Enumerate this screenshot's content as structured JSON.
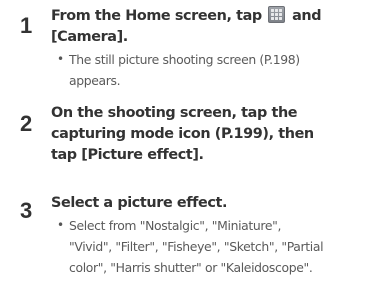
{
  "steps": [
    {
      "number": "1",
      "heading_lines": [
        "From the Home screen, tap",
        "and",
        "[Camera]."
      ],
      "icon": "apps-grid-icon",
      "body_lines": [
        "The still picture shooting screen (P.198)",
        "appears."
      ]
    },
    {
      "number": "2",
      "heading_lines": [
        "On the shooting screen, tap the",
        "capturing mode icon (P.199), then",
        "tap [Picture effect]."
      ]
    },
    {
      "number": "3",
      "heading_lines": [
        "Select a picture effect."
      ],
      "body_lines": [
        "Select from \"Nostalgic\", \"Miniature\",",
        "\"Vivid\", \"Filter\", \"Fisheye\", \"Sketch\", \"Partial",
        "color\", \"Harris shutter\" or \"Kaleidoscope\"."
      ]
    }
  ]
}
